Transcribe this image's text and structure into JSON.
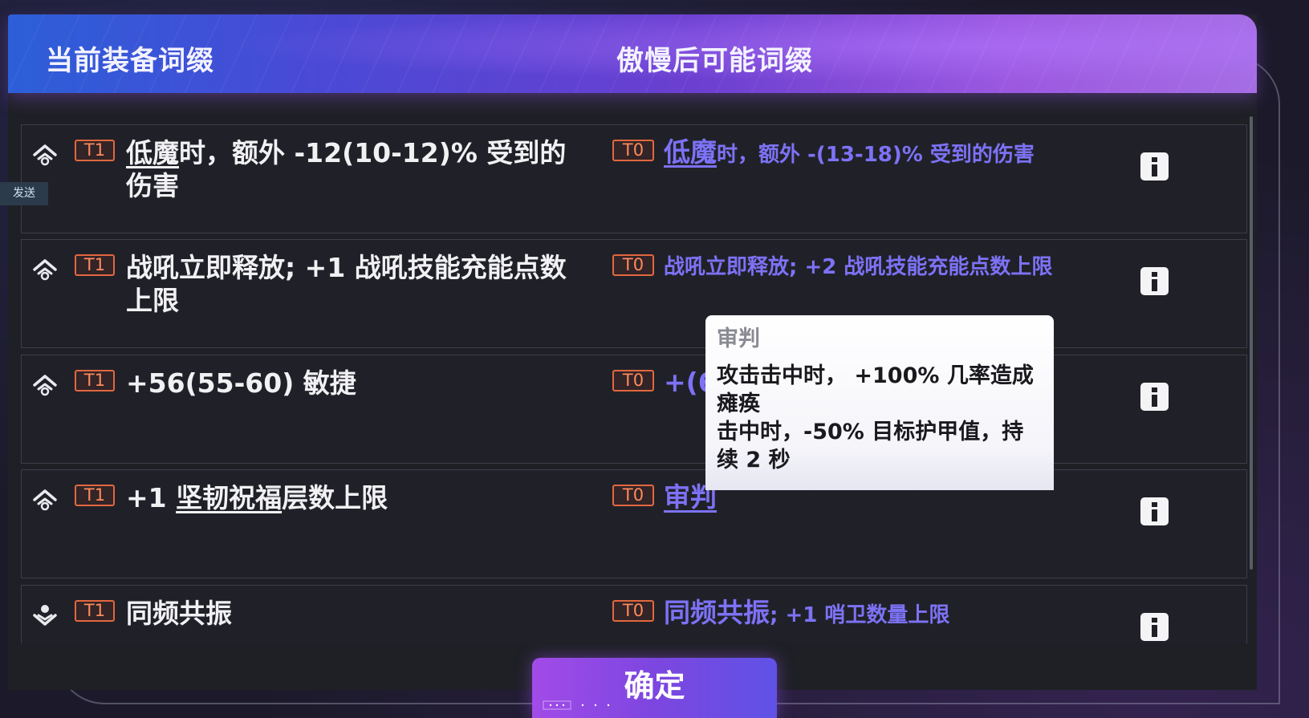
{
  "header": {
    "left_title": "当前装备词缀",
    "right_title": "傲慢后可能词缀"
  },
  "side_tag": "发送",
  "rows": [
    {
      "icon": "lock-up-icon",
      "tier": "T1",
      "current_underlined": "低魔",
      "current_rest": "时，额外 -12(10-12)% 受到的伤害",
      "new_tier": "T0",
      "new_underlined": "低魔",
      "new_rest": "时，额外 -(13-18)% 受到的伤害"
    },
    {
      "icon": "lock-up-icon",
      "tier": "T1",
      "current_prefix": "",
      "current_rest": "战吼立即释放; +1 战吼技能充能点数上限",
      "new_tier": "T0",
      "new_rest": "战吼立即释放; +2 战吼技能充能点数上限"
    },
    {
      "icon": "lock-up-icon",
      "tier": "T1",
      "current_rest": "+56(55-60) 敏捷",
      "new_tier": "T0",
      "new_rest": "+(61"
    },
    {
      "icon": "lock-up-icon",
      "tier": "T1",
      "current_prefix": "+1 ",
      "current_underlined": "坚韧祝福",
      "current_rest": "层数上限",
      "new_tier": "T0",
      "new_underlined": "审判"
    },
    {
      "icon": "lock-down-icon",
      "tier": "T1",
      "current_rest": "同频共振",
      "new_tier": "T0",
      "new_big": "同频共振",
      "new_rest": "; +1 哨卫数量上限"
    }
  ],
  "tooltip": {
    "title": "审判",
    "line1": "攻击击中时， +100% 几率造成瘫痪",
    "line2": "击中时，-50% 目标护甲值，持续 2 秒"
  },
  "confirm_label": "确定",
  "colors": {
    "tier_border": "#e2673f",
    "new_affix_text": "#7d72f6",
    "confirm_start": "#a24be8",
    "confirm_end": "#5f52e6"
  }
}
